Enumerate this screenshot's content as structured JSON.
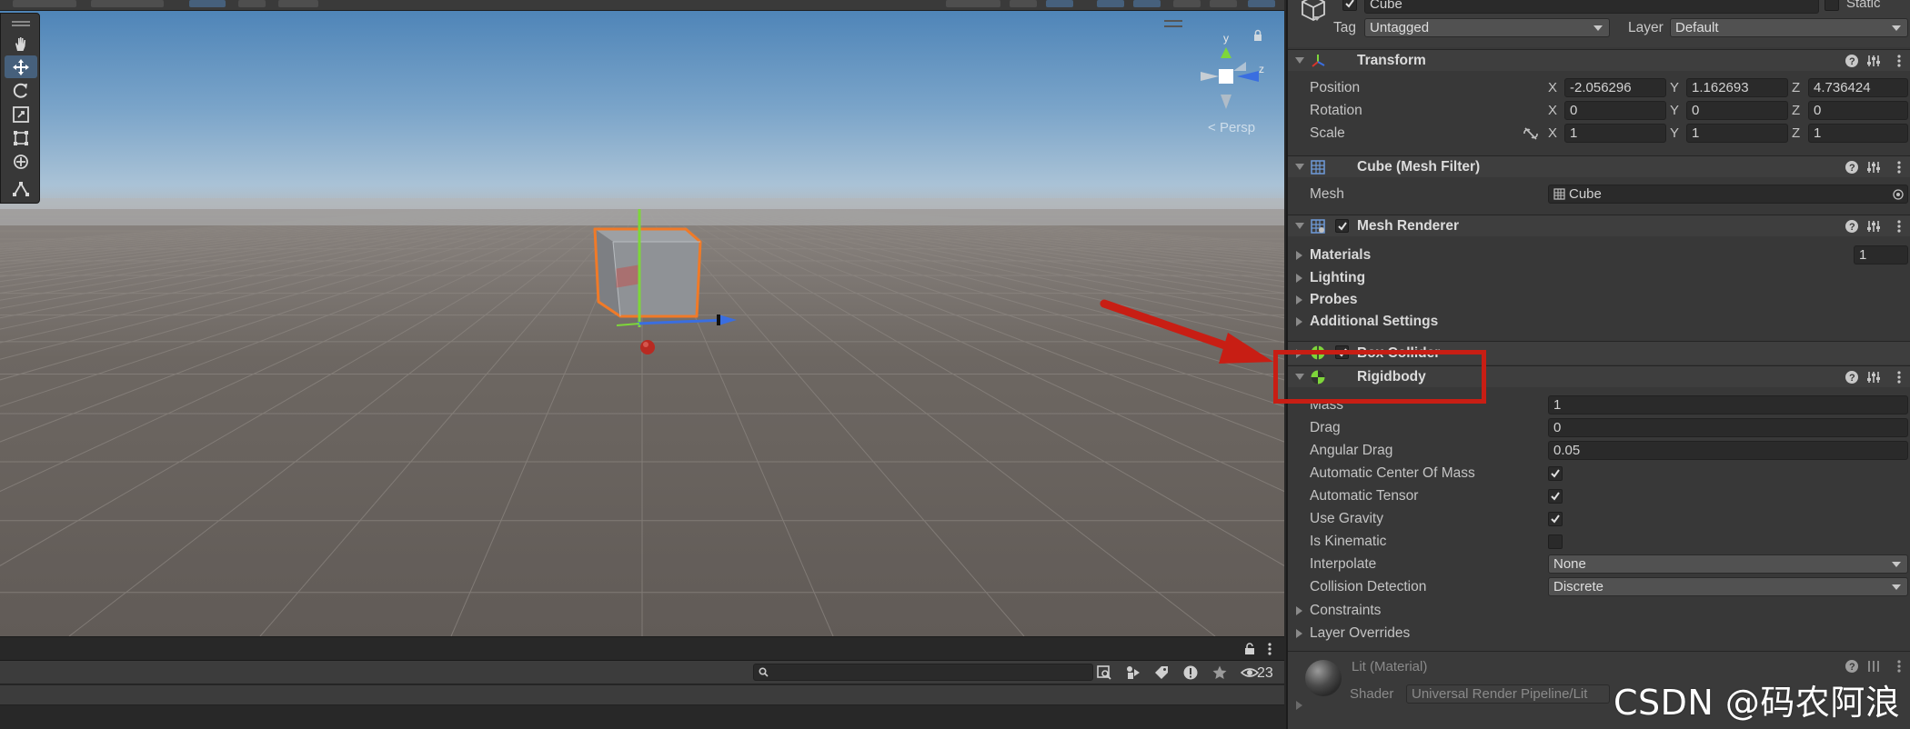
{
  "scene": {
    "persp_label": "Persp",
    "gizmo_y": "y",
    "gizmo_z": "z",
    "search_placeholder": "",
    "visible_count": "23"
  },
  "inspector": {
    "object_name": "Cube",
    "static_label": "Static",
    "tag_label": "Tag",
    "tag_value": "Untagged",
    "layer_label": "Layer",
    "layer_value": "Default",
    "transform": {
      "title": "Transform",
      "position_label": "Position",
      "rotation_label": "Rotation",
      "scale_label": "Scale",
      "axis_x": "X",
      "axis_y": "Y",
      "axis_z": "Z",
      "position": {
        "x": "-2.056296",
        "y": "1.162693",
        "z": "4.736424"
      },
      "rotation": {
        "x": "0",
        "y": "0",
        "z": "0"
      },
      "scale": {
        "x": "1",
        "y": "1",
        "z": "1"
      }
    },
    "mesh_filter": {
      "title": "Cube (Mesh Filter)",
      "mesh_label": "Mesh",
      "mesh_value": "Cube"
    },
    "mesh_renderer": {
      "title": "Mesh Renderer",
      "materials_label": "Materials",
      "materials_count": "1",
      "lighting_label": "Lighting",
      "probes_label": "Probes",
      "additional_label": "Additional Settings"
    },
    "box_collider": {
      "title": "Box Collider"
    },
    "rigidbody": {
      "title": "Rigidbody",
      "mass_label": "Mass",
      "mass": "1",
      "drag_label": "Drag",
      "drag": "0",
      "angular_drag_label": "Angular Drag",
      "angular_drag": "0.05",
      "auto_com_label": "Automatic Center Of Mass",
      "auto_com": true,
      "auto_tensor_label": "Automatic Tensor",
      "auto_tensor": true,
      "use_gravity_label": "Use Gravity",
      "use_gravity": true,
      "is_kinematic_label": "Is Kinematic",
      "is_kinematic": false,
      "interpolate_label": "Interpolate",
      "interpolate": "None",
      "collision_label": "Collision Detection",
      "collision": "Discrete",
      "constraints_label": "Constraints",
      "layer_overrides_label": "Layer Overrides"
    },
    "material": {
      "title": "Lit (Material)",
      "shader_label": "Shader",
      "shader_value": "Universal Render Pipeline/Lit"
    }
  },
  "watermark": "CSDN @码农阿浪",
  "colors": {
    "annotation_red": "#c81e14",
    "selection_orange": "#f07a28",
    "axis_x": "#d9342b",
    "axis_y": "#7ed63a",
    "axis_z": "#3a6ee0"
  }
}
